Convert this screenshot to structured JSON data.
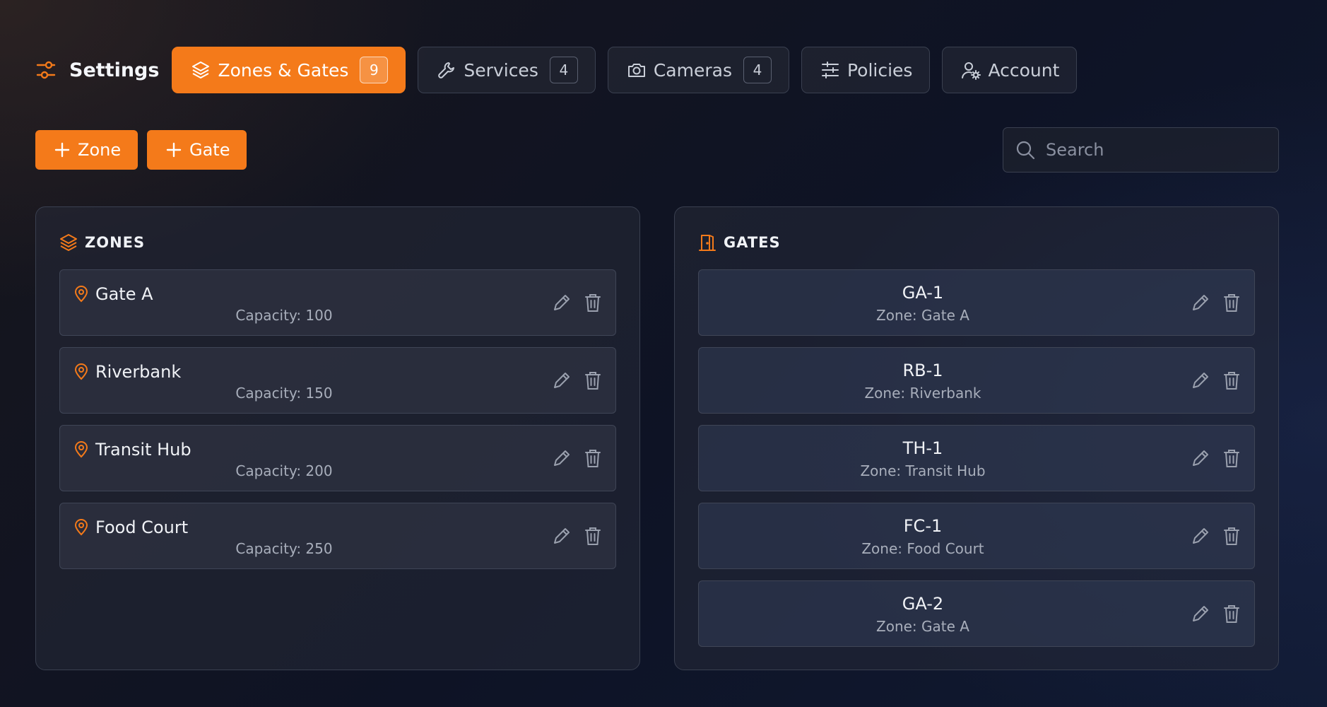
{
  "header": {
    "title": "Settings",
    "tabs": [
      {
        "label": "Zones & Gates",
        "badge": "9",
        "active": true,
        "icon": "layers-icon"
      },
      {
        "label": "Services",
        "badge": "4",
        "active": false,
        "icon": "wrench-icon"
      },
      {
        "label": "Cameras",
        "badge": "4",
        "active": false,
        "icon": "camera-icon"
      },
      {
        "label": "Policies",
        "badge": null,
        "active": false,
        "icon": "sliders-icon"
      },
      {
        "label": "Account",
        "badge": null,
        "active": false,
        "icon": "user-gear-icon"
      }
    ]
  },
  "toolbar": {
    "add_zone_label": "Zone",
    "add_gate_label": "Gate",
    "search_placeholder": "Search"
  },
  "zones": {
    "title": "ZONES",
    "items": [
      {
        "name": "Gate A",
        "detail": "Capacity: 100"
      },
      {
        "name": "Riverbank",
        "detail": "Capacity: 150"
      },
      {
        "name": "Transit Hub",
        "detail": "Capacity: 200"
      },
      {
        "name": "Food Court",
        "detail": "Capacity: 250"
      }
    ]
  },
  "gates": {
    "title": "GATES",
    "items": [
      {
        "name": "GA-1",
        "detail": "Zone: Gate A"
      },
      {
        "name": "RB-1",
        "detail": "Zone: Riverbank"
      },
      {
        "name": "TH-1",
        "detail": "Zone: Transit Hub"
      },
      {
        "name": "FC-1",
        "detail": "Zone: Food Court"
      },
      {
        "name": "GA-2",
        "detail": "Zone: Gate A"
      }
    ]
  },
  "colors": {
    "accent": "#f47a1a",
    "background": "#0e1325",
    "panel_border": "#3a4050",
    "muted_icon": "#8a90a0"
  }
}
